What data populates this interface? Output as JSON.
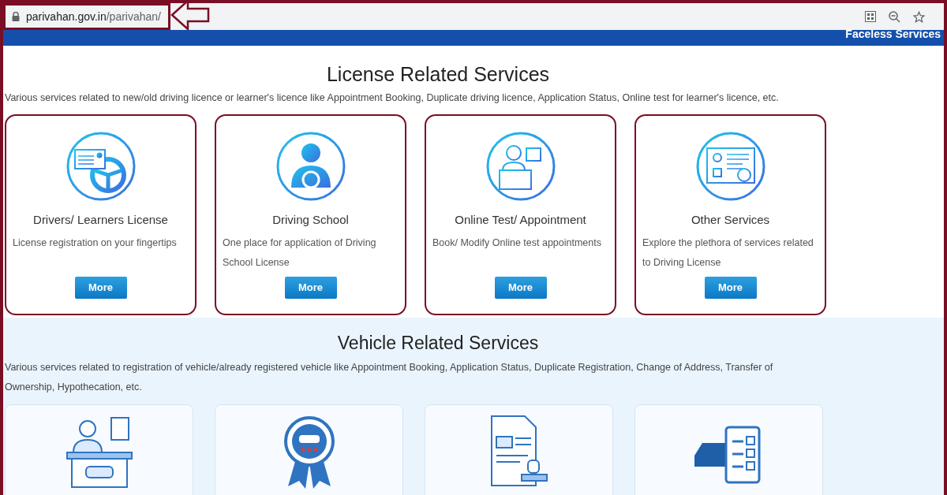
{
  "browser": {
    "url_host": "parivahan.gov.in",
    "url_path": "/parivahan/",
    "url_highlighted": true
  },
  "banner": {
    "text": "Faceless Services"
  },
  "license_section": {
    "heading": "License Related Services",
    "description": "Various services related to new/old driving licence or learner's licence like Appointment Booking, Duplicate driving licence, Application Status, Online test for learner's licence, etc.",
    "cards": [
      {
        "kind": "license",
        "highlighted": true,
        "title": "Drivers/ Learners License",
        "description": "License registration on your fingertips",
        "button": "More"
      },
      {
        "kind": "school",
        "highlighted": true,
        "title": "Driving School",
        "description": "One place for application of Driving School License",
        "button": "More"
      },
      {
        "kind": "test",
        "highlighted": true,
        "title": "Online Test/ Appointment",
        "description": "Book/ Modify Online test appointments",
        "button": "More"
      },
      {
        "kind": "other",
        "highlighted": true,
        "title": "Other Services",
        "description": "Explore the plethora of services related to Driving License",
        "button": "More"
      }
    ]
  },
  "vehicle_section": {
    "heading": "Vehicle Related Services",
    "description": "Various services related to registration of vehicle/already registered vehicle like Appointment Booking, Application Status, Duplicate Registration, Change of Address, Transfer of Ownership, Hypothecation, etc.",
    "cards": [
      {
        "kind": "desk",
        "highlighted": false
      },
      {
        "kind": "badge",
        "highlighted": false
      },
      {
        "kind": "document",
        "highlighted": false
      },
      {
        "kind": "checklist",
        "highlighted": false
      }
    ]
  }
}
